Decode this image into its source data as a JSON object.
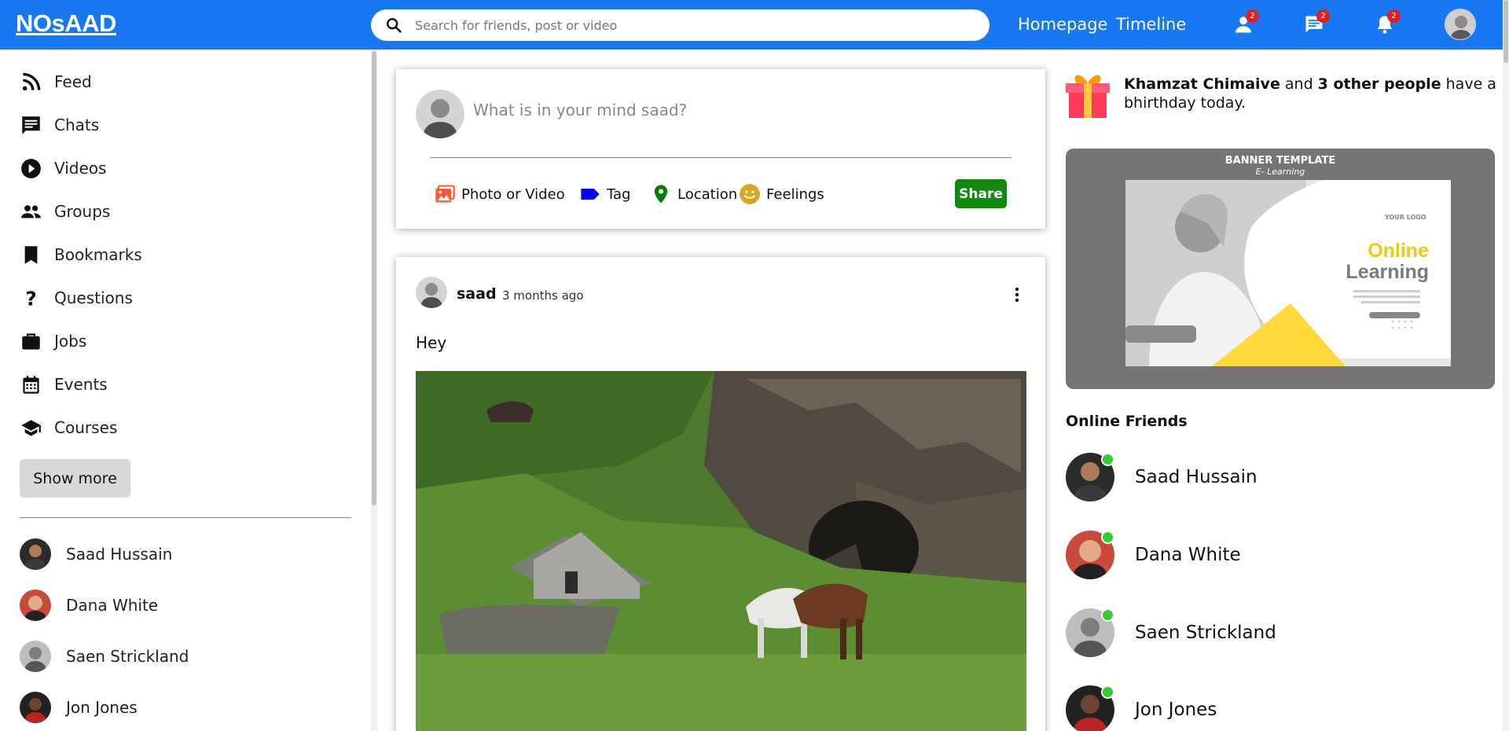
{
  "header": {
    "logo": "NOsAAD",
    "search_placeholder": "Search for friends, post or video",
    "links": [
      "Homepage",
      "Timeline"
    ],
    "badges": {
      "friends": "2",
      "messages": "2",
      "notifications": "2"
    }
  },
  "sidebar": {
    "items": [
      {
        "label": "Feed",
        "icon": "rss-icon"
      },
      {
        "label": "Chats",
        "icon": "chat-icon"
      },
      {
        "label": "Videos",
        "icon": "play-circle-icon"
      },
      {
        "label": "Groups",
        "icon": "group-icon"
      },
      {
        "label": "Bookmarks",
        "icon": "bookmark-icon"
      },
      {
        "label": "Questions",
        "icon": "question-icon"
      },
      {
        "label": "Jobs",
        "icon": "briefcase-icon"
      },
      {
        "label": "Events",
        "icon": "calendar-icon"
      },
      {
        "label": "Courses",
        "icon": "school-icon"
      }
    ],
    "show_more": "Show more",
    "friends": [
      "Saad Hussain",
      "Dana White",
      "Saen Strickland",
      "Jon Jones"
    ]
  },
  "composer": {
    "placeholder": "What is in your mind saad?",
    "options": [
      {
        "label": "Photo or Video",
        "icon": "photo-icon",
        "color": "#ff5733"
      },
      {
        "label": "Tag",
        "icon": "tag-icon",
        "color": "#0000ff"
      },
      {
        "label": "Location",
        "icon": "location-icon",
        "color": "#008000"
      },
      {
        "label": "Feelings",
        "icon": "emoji-icon",
        "color": "#daa520"
      }
    ],
    "share_label": "Share"
  },
  "post": {
    "username": "saad",
    "time": "3 months ago",
    "text": "Hey"
  },
  "birthday": {
    "name": "Khamzat Chimaive",
    "middle": " and ",
    "others": "3 other people",
    "suffix": " have a bhirthday today."
  },
  "banner": {
    "title": "BANNER TEMPLATE",
    "subtitle": "E- Learning",
    "line1": "Online",
    "line2": "Learning",
    "logo": "YOUR LOGO"
  },
  "online_friends": {
    "heading": "Online Friends",
    "list": [
      "Saad Hussain",
      "Dana White",
      "Saen Strickland",
      "Jon Jones"
    ]
  },
  "colors": {
    "header": "#1877f2",
    "share": "#0f8a0f",
    "online_dot": "#32cd32",
    "badge": "#e31d1d"
  }
}
